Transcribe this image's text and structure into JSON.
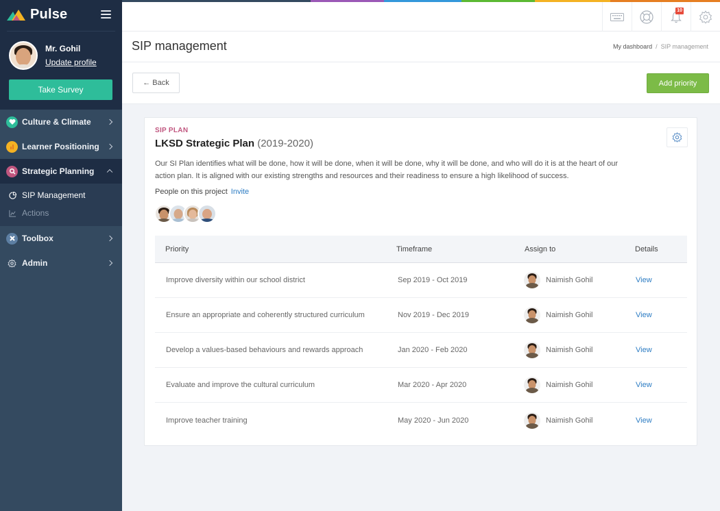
{
  "app": {
    "name": "Pulse"
  },
  "colors": {
    "sidebar_bg": "#344a60",
    "sidebar_top_bg": "#1e2d44",
    "survey_button": "#2ebd9a",
    "add_button": "#7cbb47",
    "eyebrow": "#c0567f",
    "link": "#2c7cc3",
    "badge": "#e74c3c",
    "strip": [
      "#344a60",
      "#9b59b6",
      "#3498db",
      "#5cb933",
      "#f4b223",
      "#e67e22"
    ]
  },
  "user": {
    "name": "Mr. Gohil",
    "profile_link": "Update profile",
    "survey_button": "Take Survey"
  },
  "sidebar": {
    "items": [
      {
        "label": "Culture & Climate",
        "icon": "heart-icon",
        "color": "#2ebd9a",
        "expanded": false
      },
      {
        "label": "Learner Positioning",
        "icon": "chart-icon",
        "color": "#f4b223",
        "expanded": false
      },
      {
        "label": "Strategic Planning",
        "icon": "search-icon",
        "color": "#c0567f",
        "expanded": true
      },
      {
        "label": "Toolbox",
        "icon": "tools-icon",
        "color": "#5d7fa3",
        "expanded": false
      },
      {
        "label": "Admin",
        "icon": "gear-icon",
        "color": "none",
        "expanded": false
      }
    ],
    "submenu": [
      {
        "label": "SIP Management",
        "icon": "pie-chart-icon",
        "current": true
      },
      {
        "label": "Actions",
        "icon": "line-chart-icon",
        "current": false
      }
    ]
  },
  "topbar": {
    "icons": [
      "keyboard-icon",
      "help-lifebuoy-icon",
      "bell-icon",
      "settings-gear-icon"
    ],
    "notification_count": "10"
  },
  "header": {
    "title": "SIP management",
    "breadcrumb": {
      "home": "My dashboard",
      "separator": "/",
      "current": "SIP management"
    }
  },
  "actions": {
    "back_label": "Back",
    "add_label": "Add priority"
  },
  "plan": {
    "eyebrow": "SIP PLAN",
    "title": "LKSD Strategic Plan",
    "years": "(2019-2020)",
    "description": "Our SI Plan identifies what will be done, how it will be done, when it will be done, why it will be done, and who will do it is at the heart of our action plan. It is aligned with our existing strengths and resources and their readiness to ensure a high likelihood of success.",
    "people_label": "People on this project",
    "invite_label": "Invite",
    "people_count": 4
  },
  "table": {
    "headers": [
      "Priority",
      "Timeframe",
      "Assign to",
      "Details"
    ],
    "rows": [
      {
        "priority": "Improve diversity within our school district",
        "timeframe": "Sep 2019 - Oct 2019",
        "assignee": "Naimish Gohil",
        "details": "View"
      },
      {
        "priority": "Ensure an appropriate and coherently structured curriculum",
        "timeframe": "Nov 2019 - Dec 2019",
        "assignee": "Naimish Gohil",
        "details": "View"
      },
      {
        "priority": "Develop a values-based behaviours and rewards approach",
        "timeframe": "Jan 2020 - Feb 2020",
        "assignee": "Naimish Gohil",
        "details": "View"
      },
      {
        "priority": "Evaluate and improve the cultural curriculum",
        "timeframe": "Mar 2020 - Apr 2020",
        "assignee": "Naimish Gohil",
        "details": "View"
      },
      {
        "priority": "Improve teacher training",
        "timeframe": "May 2020 - Jun 2020",
        "assignee": "Naimish Gohil",
        "details": "View"
      }
    ]
  }
}
